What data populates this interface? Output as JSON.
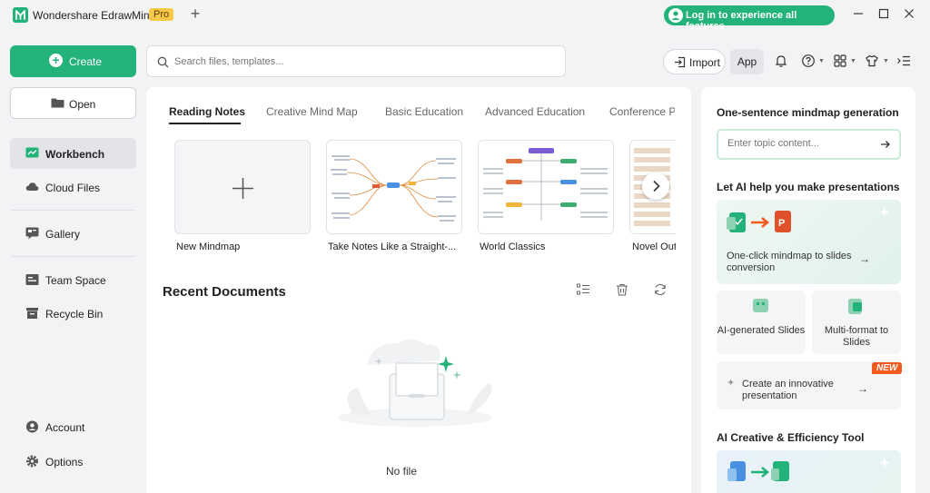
{
  "titlebar": {
    "app_title": "Wondershare EdrawMind",
    "badge": "Pro",
    "new_tab": "+",
    "login_label": "Log in to experience all features"
  },
  "sidebar": {
    "create_label": "Create",
    "open_label": "Open",
    "items": [
      {
        "label": "Workbench",
        "icon": "workbench-icon"
      },
      {
        "label": "Cloud Files",
        "icon": "cloud-icon"
      },
      {
        "label": "Gallery",
        "icon": "gallery-icon"
      },
      {
        "label": "Team Space",
        "icon": "team-icon"
      },
      {
        "label": "Recycle Bin",
        "icon": "recycle-bin-icon"
      },
      {
        "label": "Account",
        "icon": "account-icon"
      },
      {
        "label": "Options",
        "icon": "gear-icon"
      }
    ]
  },
  "topbar": {
    "search_placeholder": "Search files, templates...",
    "import_label": "Import",
    "app_label": "App"
  },
  "main": {
    "tabs": [
      "Reading Notes",
      "Creative Mind Map",
      "Basic Education",
      "Advanced Education",
      "Conference P"
    ],
    "templates": [
      {
        "name": "New Mindmap"
      },
      {
        "name": "Take Notes Like a Straight-..."
      },
      {
        "name": "World Classics"
      },
      {
        "name": "Novel Out"
      }
    ],
    "recent_title": "Recent Documents",
    "empty_text": "No file"
  },
  "right": {
    "gen_title": "One-sentence mindmap generation",
    "topic_placeholder": "Enter topic content...",
    "pres_title": "Let AI help you make presentations",
    "card_main": "One-click mindmap to slides conversion",
    "card_ai_slides": "AI-generated Slides",
    "card_multi": "Multi-format to Slides",
    "card_innovative": "Create an innovative presentation",
    "new_badge": "NEW",
    "tool_title": "AI Creative & Efficiency Tool"
  },
  "colors": {
    "accent": "#23b27a",
    "badge": "#f7c948",
    "new_badge": "#f25a1e"
  }
}
